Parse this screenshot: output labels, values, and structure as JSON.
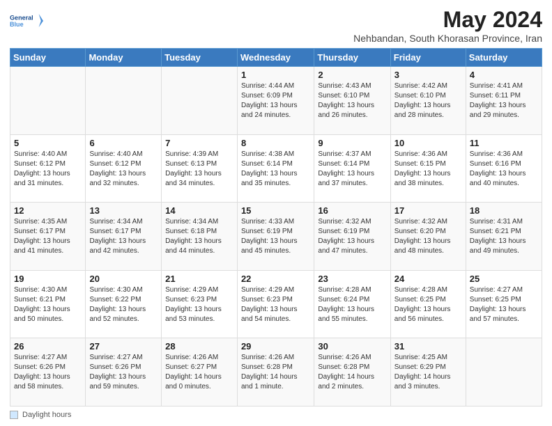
{
  "logo": {
    "line1": "General",
    "line2": "Blue"
  },
  "title": "May 2024",
  "subtitle": "Nehbandan, South Khorasan Province, Iran",
  "days_header": [
    "Sunday",
    "Monday",
    "Tuesday",
    "Wednesday",
    "Thursday",
    "Friday",
    "Saturday"
  ],
  "weeks": [
    [
      {
        "day": "",
        "detail": ""
      },
      {
        "day": "",
        "detail": ""
      },
      {
        "day": "",
        "detail": ""
      },
      {
        "day": "1",
        "detail": "Sunrise: 4:44 AM\nSunset: 6:09 PM\nDaylight: 13 hours\nand 24 minutes."
      },
      {
        "day": "2",
        "detail": "Sunrise: 4:43 AM\nSunset: 6:10 PM\nDaylight: 13 hours\nand 26 minutes."
      },
      {
        "day": "3",
        "detail": "Sunrise: 4:42 AM\nSunset: 6:10 PM\nDaylight: 13 hours\nand 28 minutes."
      },
      {
        "day": "4",
        "detail": "Sunrise: 4:41 AM\nSunset: 6:11 PM\nDaylight: 13 hours\nand 29 minutes."
      }
    ],
    [
      {
        "day": "5",
        "detail": "Sunrise: 4:40 AM\nSunset: 6:12 PM\nDaylight: 13 hours\nand 31 minutes."
      },
      {
        "day": "6",
        "detail": "Sunrise: 4:40 AM\nSunset: 6:12 PM\nDaylight: 13 hours\nand 32 minutes."
      },
      {
        "day": "7",
        "detail": "Sunrise: 4:39 AM\nSunset: 6:13 PM\nDaylight: 13 hours\nand 34 minutes."
      },
      {
        "day": "8",
        "detail": "Sunrise: 4:38 AM\nSunset: 6:14 PM\nDaylight: 13 hours\nand 35 minutes."
      },
      {
        "day": "9",
        "detail": "Sunrise: 4:37 AM\nSunset: 6:14 PM\nDaylight: 13 hours\nand 37 minutes."
      },
      {
        "day": "10",
        "detail": "Sunrise: 4:36 AM\nSunset: 6:15 PM\nDaylight: 13 hours\nand 38 minutes."
      },
      {
        "day": "11",
        "detail": "Sunrise: 4:36 AM\nSunset: 6:16 PM\nDaylight: 13 hours\nand 40 minutes."
      }
    ],
    [
      {
        "day": "12",
        "detail": "Sunrise: 4:35 AM\nSunset: 6:17 PM\nDaylight: 13 hours\nand 41 minutes."
      },
      {
        "day": "13",
        "detail": "Sunrise: 4:34 AM\nSunset: 6:17 PM\nDaylight: 13 hours\nand 42 minutes."
      },
      {
        "day": "14",
        "detail": "Sunrise: 4:34 AM\nSunset: 6:18 PM\nDaylight: 13 hours\nand 44 minutes."
      },
      {
        "day": "15",
        "detail": "Sunrise: 4:33 AM\nSunset: 6:19 PM\nDaylight: 13 hours\nand 45 minutes."
      },
      {
        "day": "16",
        "detail": "Sunrise: 4:32 AM\nSunset: 6:19 PM\nDaylight: 13 hours\nand 47 minutes."
      },
      {
        "day": "17",
        "detail": "Sunrise: 4:32 AM\nSunset: 6:20 PM\nDaylight: 13 hours\nand 48 minutes."
      },
      {
        "day": "18",
        "detail": "Sunrise: 4:31 AM\nSunset: 6:21 PM\nDaylight: 13 hours\nand 49 minutes."
      }
    ],
    [
      {
        "day": "19",
        "detail": "Sunrise: 4:30 AM\nSunset: 6:21 PM\nDaylight: 13 hours\nand 50 minutes."
      },
      {
        "day": "20",
        "detail": "Sunrise: 4:30 AM\nSunset: 6:22 PM\nDaylight: 13 hours\nand 52 minutes."
      },
      {
        "day": "21",
        "detail": "Sunrise: 4:29 AM\nSunset: 6:23 PM\nDaylight: 13 hours\nand 53 minutes."
      },
      {
        "day": "22",
        "detail": "Sunrise: 4:29 AM\nSunset: 6:23 PM\nDaylight: 13 hours\nand 54 minutes."
      },
      {
        "day": "23",
        "detail": "Sunrise: 4:28 AM\nSunset: 6:24 PM\nDaylight: 13 hours\nand 55 minutes."
      },
      {
        "day": "24",
        "detail": "Sunrise: 4:28 AM\nSunset: 6:25 PM\nDaylight: 13 hours\nand 56 minutes."
      },
      {
        "day": "25",
        "detail": "Sunrise: 4:27 AM\nSunset: 6:25 PM\nDaylight: 13 hours\nand 57 minutes."
      }
    ],
    [
      {
        "day": "26",
        "detail": "Sunrise: 4:27 AM\nSunset: 6:26 PM\nDaylight: 13 hours\nand 58 minutes."
      },
      {
        "day": "27",
        "detail": "Sunrise: 4:27 AM\nSunset: 6:26 PM\nDaylight: 13 hours\nand 59 minutes."
      },
      {
        "day": "28",
        "detail": "Sunrise: 4:26 AM\nSunset: 6:27 PM\nDaylight: 14 hours\nand 0 minutes."
      },
      {
        "day": "29",
        "detail": "Sunrise: 4:26 AM\nSunset: 6:28 PM\nDaylight: 14 hours\nand 1 minute."
      },
      {
        "day": "30",
        "detail": "Sunrise: 4:26 AM\nSunset: 6:28 PM\nDaylight: 14 hours\nand 2 minutes."
      },
      {
        "day": "31",
        "detail": "Sunrise: 4:25 AM\nSunset: 6:29 PM\nDaylight: 14 hours\nand 3 minutes."
      },
      {
        "day": "",
        "detail": ""
      }
    ]
  ],
  "footer": {
    "label": "Daylight hours"
  }
}
